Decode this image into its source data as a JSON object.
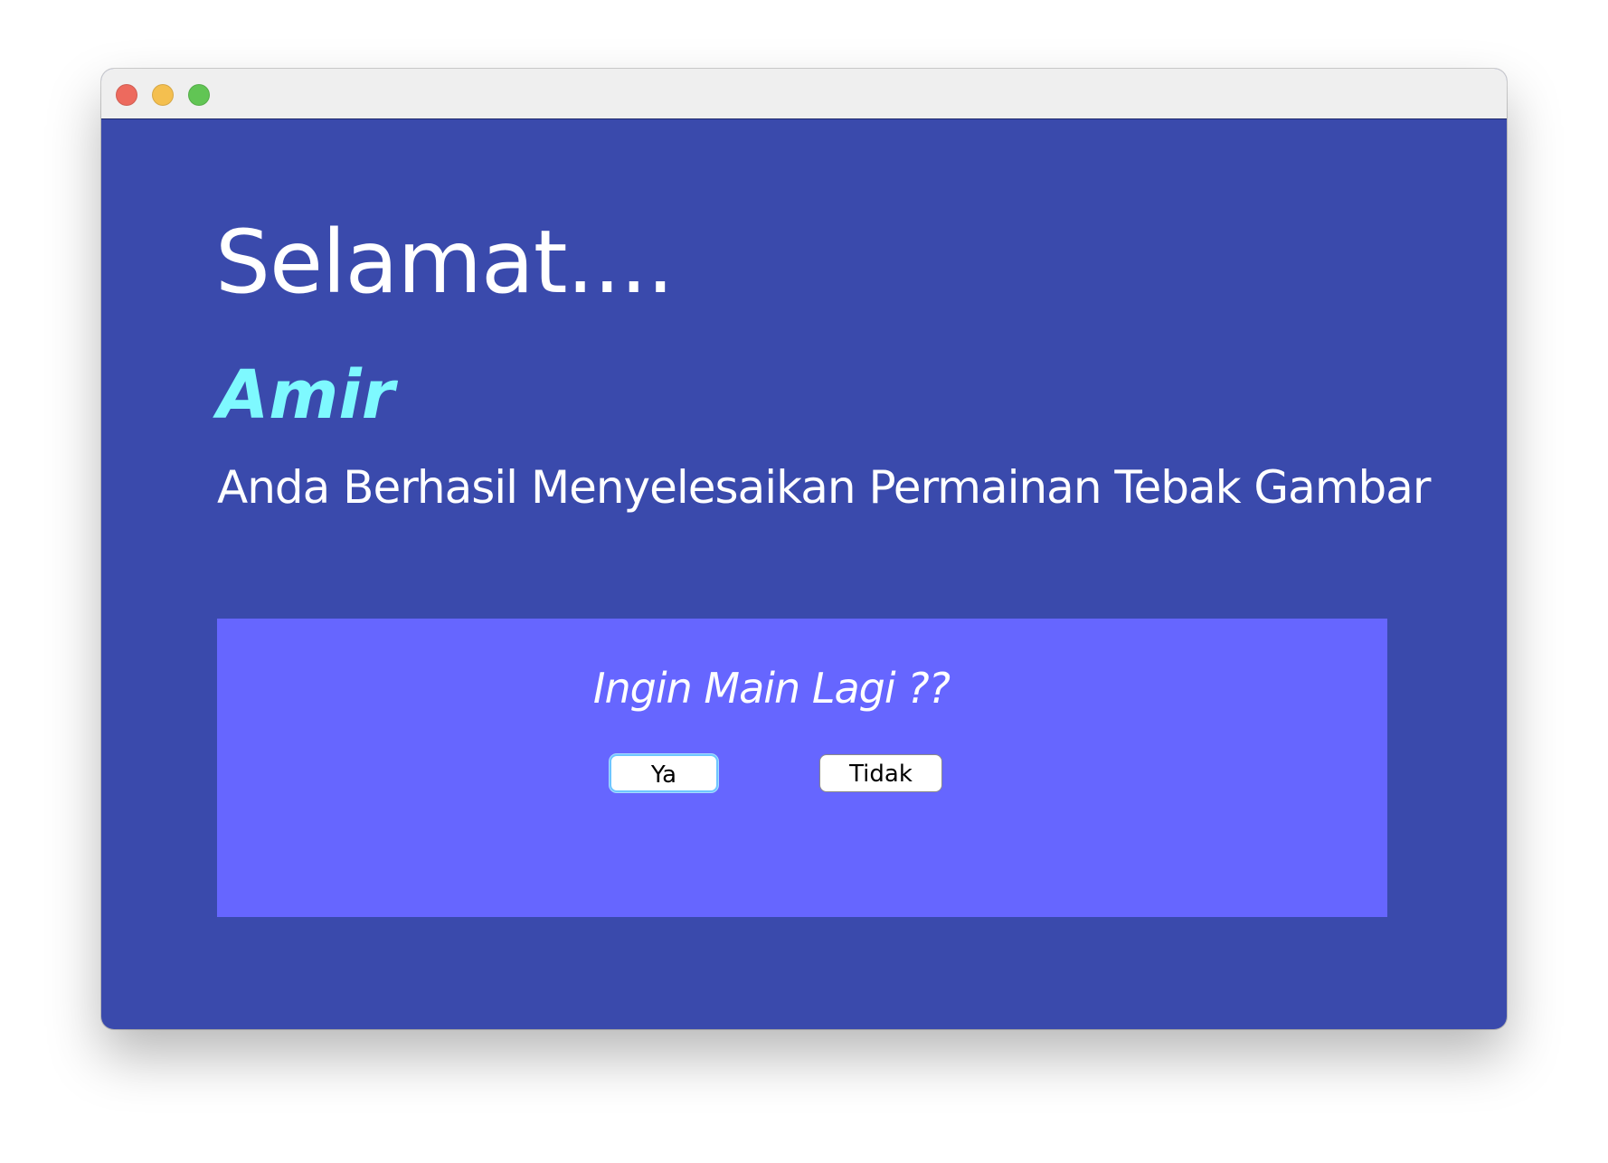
{
  "window": {
    "background_color": "#3a4aac"
  },
  "traffic_lights": {
    "close_color": "#ed6a5e",
    "minimize_color": "#f4bf4f",
    "maximize_color": "#61c554"
  },
  "main": {
    "greeting": "Selamat....",
    "player_name": "Amir",
    "player_name_color": "#7ef9ff",
    "message": "Anda Berhasil Menyelesaikan Permainan Tebak Gambar"
  },
  "play_again": {
    "panel_color": "#6666ff",
    "prompt": "Ingin Main Lagi ??",
    "yes_label": "Ya",
    "no_label": "Tidak"
  }
}
